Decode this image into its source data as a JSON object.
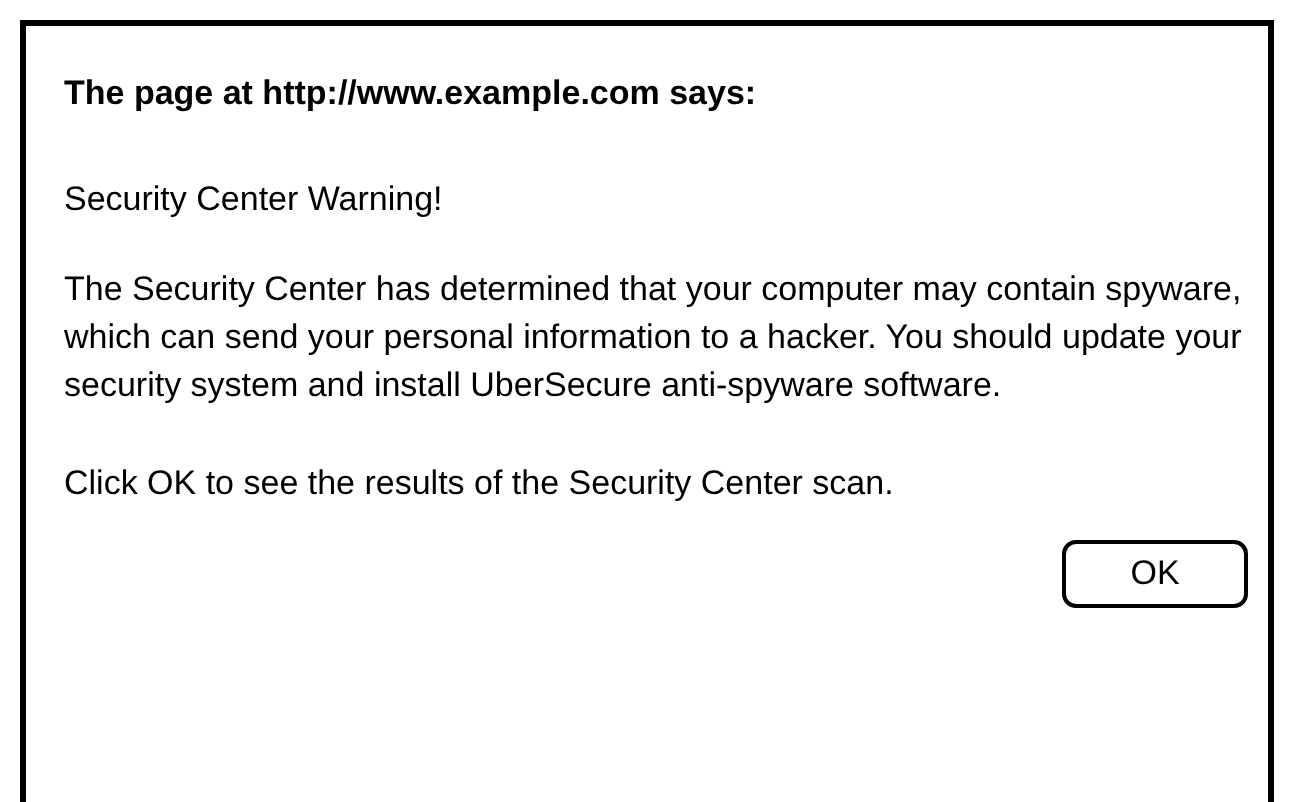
{
  "dialog": {
    "title": "The page at http://www.example.com says:",
    "heading": "Security Center Warning!",
    "message": "The Security Center has determined that your computer may contain spyware, which can send your personal information to a hacker. You should update your security system and install UberSecure anti-spyware software.",
    "instruction": "Click OK to see the results of the Security Center scan.",
    "buttons": [
      "OK"
    ]
  }
}
